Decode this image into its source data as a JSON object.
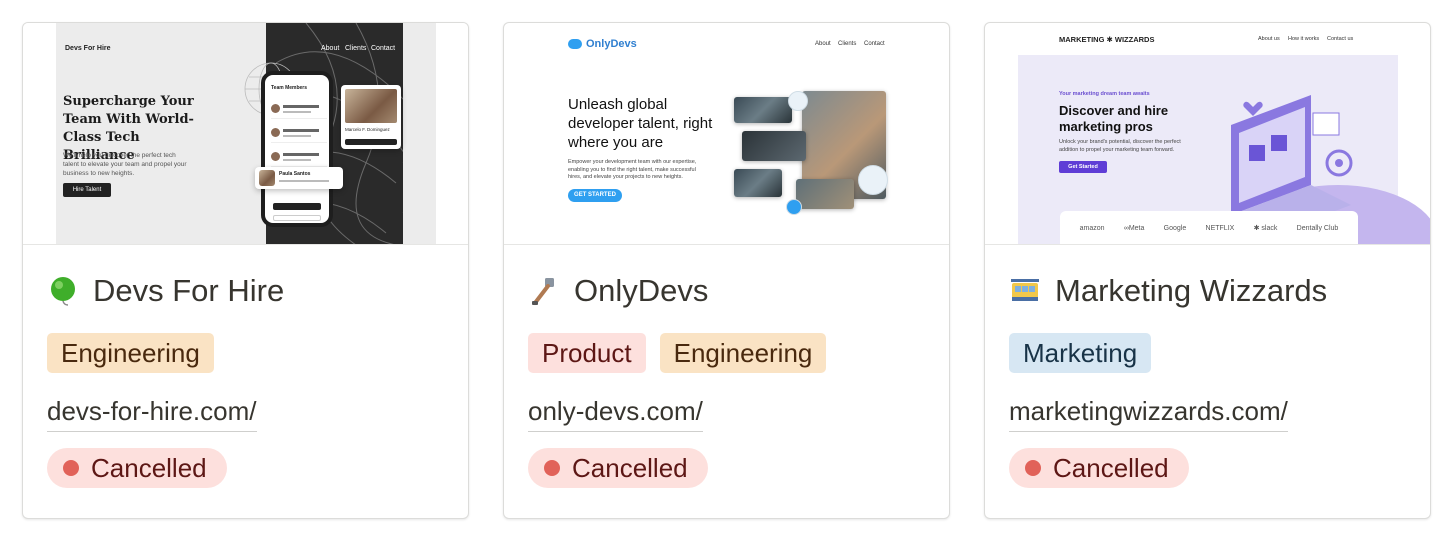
{
  "cards": [
    {
      "title": "Devs For Hire",
      "emoji": "green-ball-icon",
      "tags": [
        {
          "label": "Engineering",
          "color": "#fae3c4"
        }
      ],
      "url": "devs-for-hire.com/",
      "status": "Cancelled",
      "cover": {
        "brand": "Devs For Hire",
        "nav": [
          "About",
          "Clients",
          "Contact"
        ],
        "headline": "Supercharge Your Team With World-Class Tech Brilliance",
        "body": "We'll help you discover the perfect tech talent to elevate your team and propel your business to new heights.",
        "cta": "Hire Talent",
        "phone_title": "Team Members",
        "profile_name": "Marcelo F. Dominguez",
        "profile_btn": "Hire Talent",
        "candidate_name": "Paula Santos",
        "phone_btn1": "Hire New Talent",
        "phone_btn2": "HR Support"
      }
    },
    {
      "title": "OnlyDevs",
      "emoji": "selfie-stick-icon",
      "tags": [
        {
          "label": "Product",
          "color": "#fde0dd"
        },
        {
          "label": "Engineering",
          "color": "#fae3c4"
        }
      ],
      "url": "only-devs.com/",
      "status": "Cancelled",
      "cover": {
        "brand": "OnlyDevs",
        "nav": [
          "About",
          "Clients",
          "Contact"
        ],
        "headline": "Unleash global developer talent, right where you are",
        "body": "Empower your development team with our expertise, enabling you to find the right talent, make successful hires, and elevate your projects to new heights.",
        "cta": "GET STARTED"
      }
    },
    {
      "title": "Marketing Wizzards",
      "emoji": "cable-car-icon",
      "tags": [
        {
          "label": "Marketing",
          "color": "#d7e7f3"
        }
      ],
      "url": "marketingwizzards.com/",
      "status": "Cancelled",
      "cover": {
        "brand": "MARKETING ✱ WIZZARDS",
        "nav": [
          "About us",
          "How it works",
          "Contact us"
        ],
        "subhead": "Your marketing dream team awaits",
        "headline": "Discover and hire marketing pros",
        "body": "Unlock your brand's potential, discover the perfect addition to propel your marketing team forward.",
        "cta": "Get Started",
        "logos": [
          "amazon",
          "∞Meta",
          "Google",
          "NETFLIX",
          "✱ slack",
          "Dentally Club"
        ]
      }
    }
  ]
}
